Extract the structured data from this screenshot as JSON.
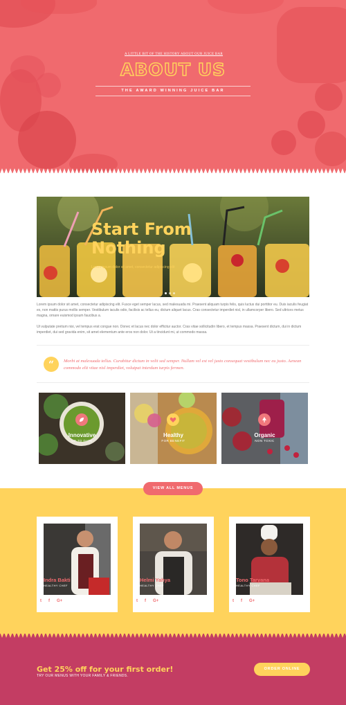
{
  "hero": {
    "tagline": "A LITTLE BIT OF THE HISTORY ABOUT OUR JUICE BAR",
    "title": "ABOUT US",
    "subtitle": "THE AWARD WINNING JUICE BAR"
  },
  "feature": {
    "title": "Start From\nNothing",
    "subtitle": "Lorem ipsum dolor sit amet, consectetur adipiscing elit"
  },
  "body": {
    "paragraph1": "Lorem ipsum dolor sit amet, consectetur adipiscing elit. Fusce eget semper lacus, sed malesuada mi. Praesent aliquam turpis felis, quis luctus dui porttitor eu. Duis iaculis feugiat ex, non mattis purus mollis semper. Vestibulum iaculis odio, facilisis ac tellus eu, dictum aliquet lacus. Cras consectetur imperdiet nisl, in ullamcorper libero. Sed ultrices metus magna, ornare euismod ipsum faucibus a.",
    "paragraph2": "Ut vulputate pretium nisi, vel tempus erat congue non. Donec et lacus nec dolor efficitur auctor. Cras vitae sollicitudin libero, et tempus massa. Praesent dictum, dui in dictum imperdiet, dui sed gravida enim, sit amet elementum ante eros non dolor. Ut a tincidunt mi, ut commodo massa."
  },
  "quote": {
    "text": "Morbi at malesuada tellus. Curabitur dictum in velit sed semper. Nullam vel est vel justo consequat vestibulum nec eu justo. Aenean commodo elit vitae nisl imperdiet, volutpat interdum turpis fermen."
  },
  "cards": [
    {
      "title": "Innovative",
      "subtitle": "UP TO DATE",
      "icon": "leaf-icon"
    },
    {
      "title": "Healthy",
      "subtitle": "FOR BENEFIT",
      "icon": "heart-icon"
    },
    {
      "title": "Organic",
      "subtitle": "NON TOXIC",
      "icon": "tree-icon"
    }
  ],
  "menus_button": "VIEW ALL MENUS",
  "team": [
    {
      "name": "Indra Bakti",
      "role": "HEALTHY CHEF"
    },
    {
      "name": "Helmi Yahya",
      "role": "HEALTHY CHEF"
    },
    {
      "name": "Tono Taryana",
      "role": "HEALTHY CHEF"
    }
  ],
  "socials": {
    "twitter": "t",
    "facebook": "f",
    "google": "G+"
  },
  "cta": {
    "title": "Get 25% off for your first order!",
    "subtitle": "TRY OUR MENUS WITH YOUR FAMILY & FRIENDS.",
    "button": "ORDER ONLINE"
  },
  "colors": {
    "coral": "#f06a6e",
    "yellow": "#ffd35c",
    "berry": "#c33d63"
  }
}
